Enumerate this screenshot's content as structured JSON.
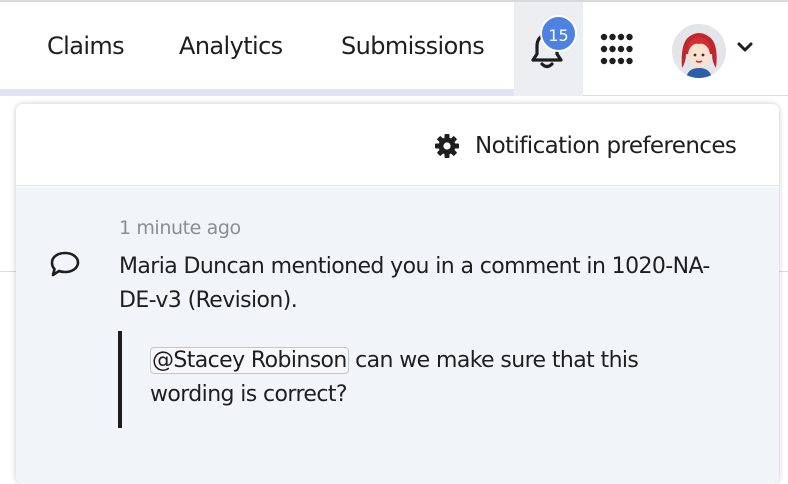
{
  "nav": {
    "items": [
      {
        "label": "Claims"
      },
      {
        "label": "Analytics"
      },
      {
        "label": "Submissions"
      }
    ]
  },
  "notifications": {
    "badge_count": "15",
    "preferences_label": "Notification preferences",
    "items": [
      {
        "time": "1 minute ago",
        "message": "Maria Duncan mentioned you in a comment in 1020-NA-DE-v3 (Revision).",
        "mention": "@Stacey Robinson",
        "comment_text": " can we make sure that this wording is correct?",
        "icon": "comment-icon"
      }
    ]
  },
  "icons": {
    "bell": "bell-icon",
    "apps": "apps-grid-icon",
    "avatar": "user-avatar",
    "chevron": "chevron-down-icon",
    "gear": "gear-icon"
  },
  "colors": {
    "badge": "#4e82e0",
    "notification_bg": "#f1f5f9",
    "active_tab_bg": "#eceef1"
  }
}
